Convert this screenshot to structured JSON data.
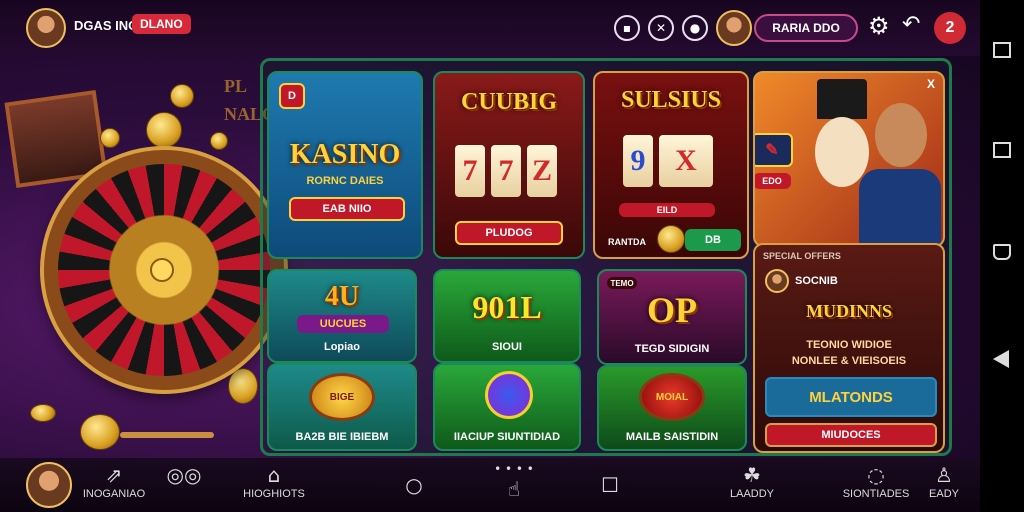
{
  "header": {
    "brand": "DGAS INO",
    "badge": "DLANO",
    "profile_name": "RARIA DDO",
    "notification_count": "2",
    "icons": [
      "wallet-icon",
      "support-icon",
      "chat-icon",
      "gear-icon",
      "back-icon"
    ]
  },
  "background": {
    "sign_line1": "PL",
    "sign_line2": "NALO"
  },
  "games": {
    "kasino": {
      "badge": "D",
      "title": "KASINO",
      "subtitle": "RORNC DAIES",
      "button": "EAB NIIO"
    },
    "cuubig": {
      "title": "CUUBIG",
      "reels": [
        "7",
        "7",
        "Z"
      ],
      "button": "PLUDOG"
    },
    "sulsius": {
      "title": "SULSIUS",
      "reels": [
        "9",
        "X"
      ],
      "bar_label": "EILD",
      "footer_left": "RANTDA",
      "footer_right": "DB"
    },
    "featured": {
      "close": "X",
      "side_button": "EDO"
    },
    "lucky": {
      "title": "4U",
      "badge_text": "UUCUES",
      "label": "Lopiao"
    },
    "slots_901": {
      "title": "901L",
      "label": "SIOUI"
    },
    "op": {
      "corner": "TEMO",
      "title": "OP",
      "label": "TEGD SIDIGIN"
    },
    "bonus": {
      "emblem": "BIGE",
      "label": "BA2B BIE IBIEBM"
    },
    "spin": {
      "label": "IIACIUP SIUNTIDIAD"
    },
    "medal": {
      "emblem": "MOIAL",
      "label": "MAILB SAISTIDIN"
    },
    "muldins": {
      "header": "SPECIAL OFFERS",
      "player": "SOCNIB",
      "title": "MUDINNS",
      "line1": "TEONIO WIDIOE",
      "line2": "NONLEE & VIEISOEIS",
      "button1": "MLATONDS",
      "button2": "MIUDOCES"
    }
  },
  "bottom_nav": [
    {
      "label": "INOGANIAO",
      "icon": "share-icon"
    },
    {
      "label": "",
      "icon": "cards-icon"
    },
    {
      "label": "HIOGHIOTS",
      "icon": "home-icon"
    },
    {
      "label": "",
      "icon": "search-icon"
    },
    {
      "label": "",
      "icon": "gesture-icon"
    },
    {
      "label": "",
      "icon": "square-icon"
    },
    {
      "label": "LAADDY",
      "icon": "people-icon"
    },
    {
      "label": "SIONTIADES",
      "icon": "support-icon"
    },
    {
      "label": "EADY",
      "icon": "person-icon"
    }
  ],
  "colors": {
    "accent_green": "#1a8a5a",
    "accent_red": "#d02a34",
    "gold": "#ffd23a"
  }
}
